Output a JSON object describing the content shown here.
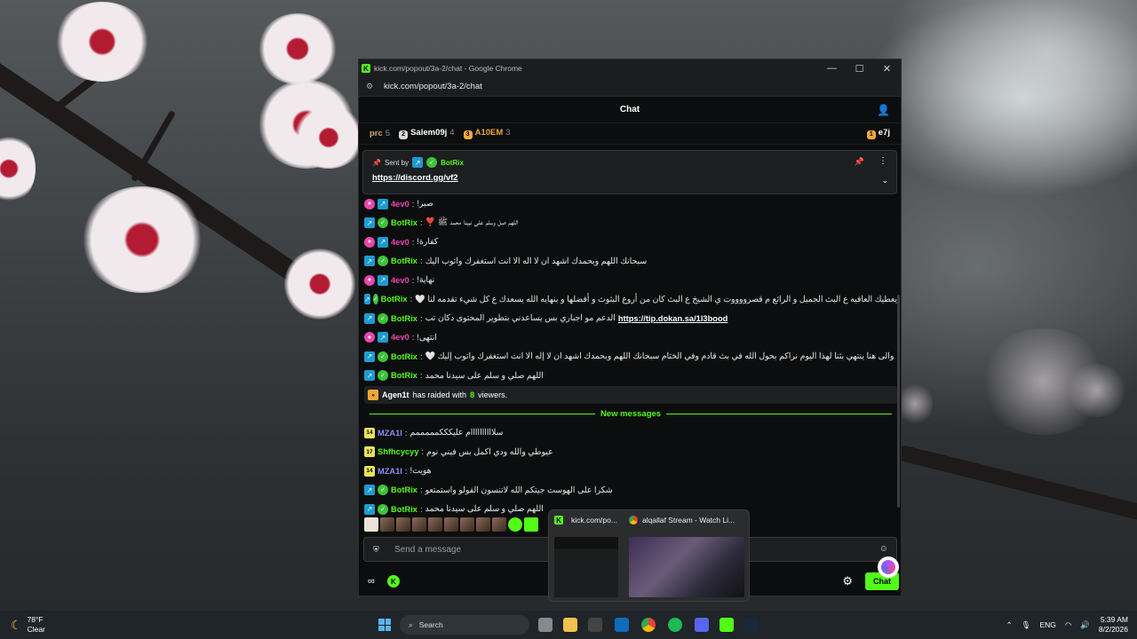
{
  "window": {
    "title": "kick.com/popout/3a-2/chat - Google Chrome",
    "url": "kick.com/popout/3a-2/chat"
  },
  "chat": {
    "header": "Chat",
    "leaderboard": [
      {
        "name": "prc",
        "count": "5",
        "color": "#c9a76b"
      },
      {
        "name": "Salem09j",
        "count": "4",
        "color": "#d8d8d8"
      },
      {
        "name": "A10EM",
        "count": "3",
        "color": "#f0a83a"
      }
    ],
    "leaderboard_right": "e7j",
    "pinned": {
      "sent_by": "Sent by",
      "user": "BotRix",
      "link": "https://discord.gg/vf2"
    },
    "messages": [
      {
        "user": "4ev0",
        "badge": "pink",
        "color": "#e946b0",
        "text": "صبر!"
      },
      {
        "user": "BotRix",
        "badge": "bot",
        "color": "#53fc18",
        "text": "اللهم صل وسلم على نبينا محمد ﷺ ❣️"
      },
      {
        "user": "4ev0",
        "badge": "pink",
        "color": "#e946b0",
        "text": "كفارة!"
      },
      {
        "user": "BotRix",
        "badge": "bot",
        "color": "#53fc18",
        "text": "سبحانك اللهم وبحمدك اشهد ان لا اله الا انت استغفرك واتوب اليك"
      },
      {
        "user": "4ev0",
        "badge": "pink",
        "color": "#e946b0",
        "text": "نهاية!"
      },
      {
        "user": "BotRix",
        "badge": "bot",
        "color": "#53fc18",
        "text": "يعطيك العافيه ع البث الجميل و الرائع م قصرووووت ي الشيخ ع البث كان من أروع البثوث و أفضلها و بنهايه الله يسعدك ع كل شيء تقدمه لنا 🤍"
      },
      {
        "user": "BotRix",
        "badge": "bot",
        "color": "#53fc18",
        "text": "الدعم مو اجباري بس يساعدني بتطوير المحتوى دكان تب",
        "link": "https://tip.dokan.sa/1l3bood"
      },
      {
        "user": "4ev0",
        "badge": "pink",
        "color": "#e946b0",
        "text": "انتهى!"
      },
      {
        "user": "BotRix",
        "badge": "bot",
        "color": "#53fc18",
        "text": "والى هنا ينتهي بثنا لهذا اليوم نراكم بحول الله في بث قادم وفي الختام سبحانك اللهم وبحمدك اشهد ان لا إله الا انت استغفرك واتوب إليك 🤍"
      },
      {
        "user": "BotRix",
        "badge": "bot",
        "color": "#53fc18",
        "text": "اللهم صلي و سلم على سيدنا محمد"
      }
    ],
    "raid": {
      "user": "Agen1t",
      "middle": "has raided with",
      "count": "8",
      "suffix": "viewers."
    },
    "new_messages_label": "New messages",
    "new_messages": [
      {
        "user": "MZA1l",
        "badge": "sub",
        "sub": "14",
        "color": "#8e8ef5",
        "text": "سلاااااااااام عليكككمممممم"
      },
      {
        "user": "Shfhcycyy",
        "badge": "sub",
        "sub": "17",
        "color": "#53fc18",
        "text": "عيوطي والله ودي اكمل بس فيني نوم"
      },
      {
        "user": "MZA1l",
        "badge": "sub",
        "sub": "14",
        "color": "#8e8ef5",
        "text": "هويت!"
      },
      {
        "user": "BotRix",
        "badge": "bot",
        "color": "#53fc18",
        "text": "شكرا على الهوست جيتكم الله لاتنسون الفولو واستمتعو"
      },
      {
        "user": "BotRix",
        "badge": "bot",
        "color": "#53fc18",
        "text": "اللهم صلي و سلم على سيدنا محمد"
      }
    ],
    "input_placeholder": "Send a message",
    "chat_button": "Chat"
  },
  "preview": {
    "tab1": "kick.com/po...",
    "tab2": "alqallaf Stream - Watch Li..."
  },
  "taskbar": {
    "temp": "78°F",
    "weather": "Clear",
    "search": "Search",
    "lang": "ENG",
    "time": "5:39 AM",
    "date": "8/2/2026"
  }
}
